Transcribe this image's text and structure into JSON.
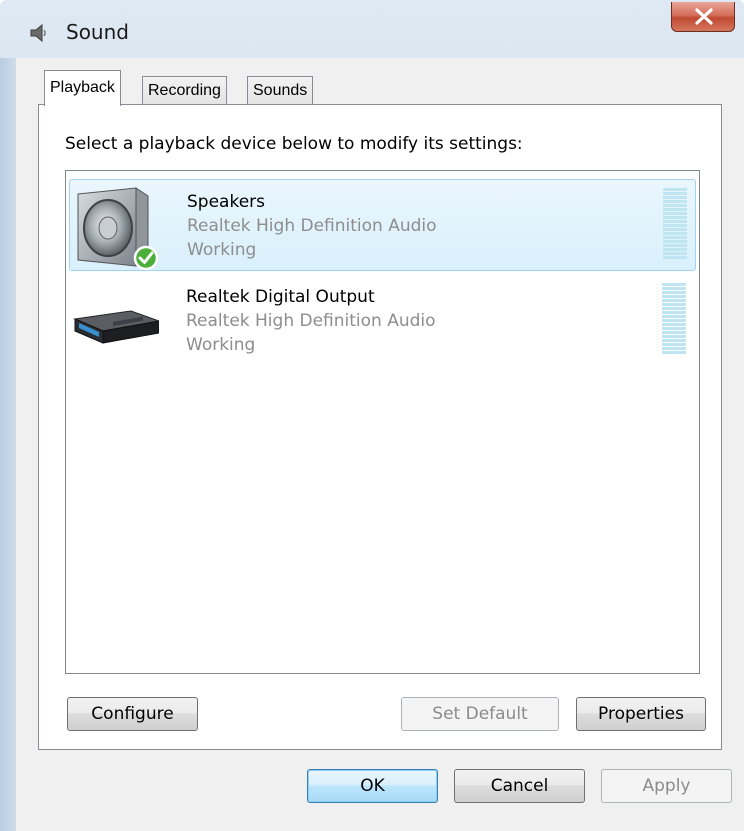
{
  "window": {
    "title": "Sound",
    "close_glyph": "X",
    "colors": {
      "close_button": "#c04a33",
      "selection": "#d9f0fc"
    }
  },
  "tabs": [
    {
      "label": "Playback",
      "active": true
    },
    {
      "label": "Recording",
      "active": false
    },
    {
      "label": "Sounds",
      "active": false
    }
  ],
  "playback": {
    "instruction": "Select a playback device below to modify its settings:",
    "devices": [
      {
        "name": "Speakers",
        "driver": "Realtek High Definition Audio",
        "status": "Working",
        "icon": "speaker-icon",
        "is_default": true,
        "selected": true
      },
      {
        "name": "Realtek Digital Output",
        "driver": "Realtek High Definition Audio",
        "status": "Working",
        "icon": "digital-output-device-icon",
        "is_default": false,
        "selected": false
      }
    ],
    "buttons": {
      "configure": "Configure",
      "set_default": "Set Default",
      "properties": "Properties"
    }
  },
  "dialog_buttons": {
    "ok": "OK",
    "cancel": "Cancel",
    "apply": "Apply"
  }
}
